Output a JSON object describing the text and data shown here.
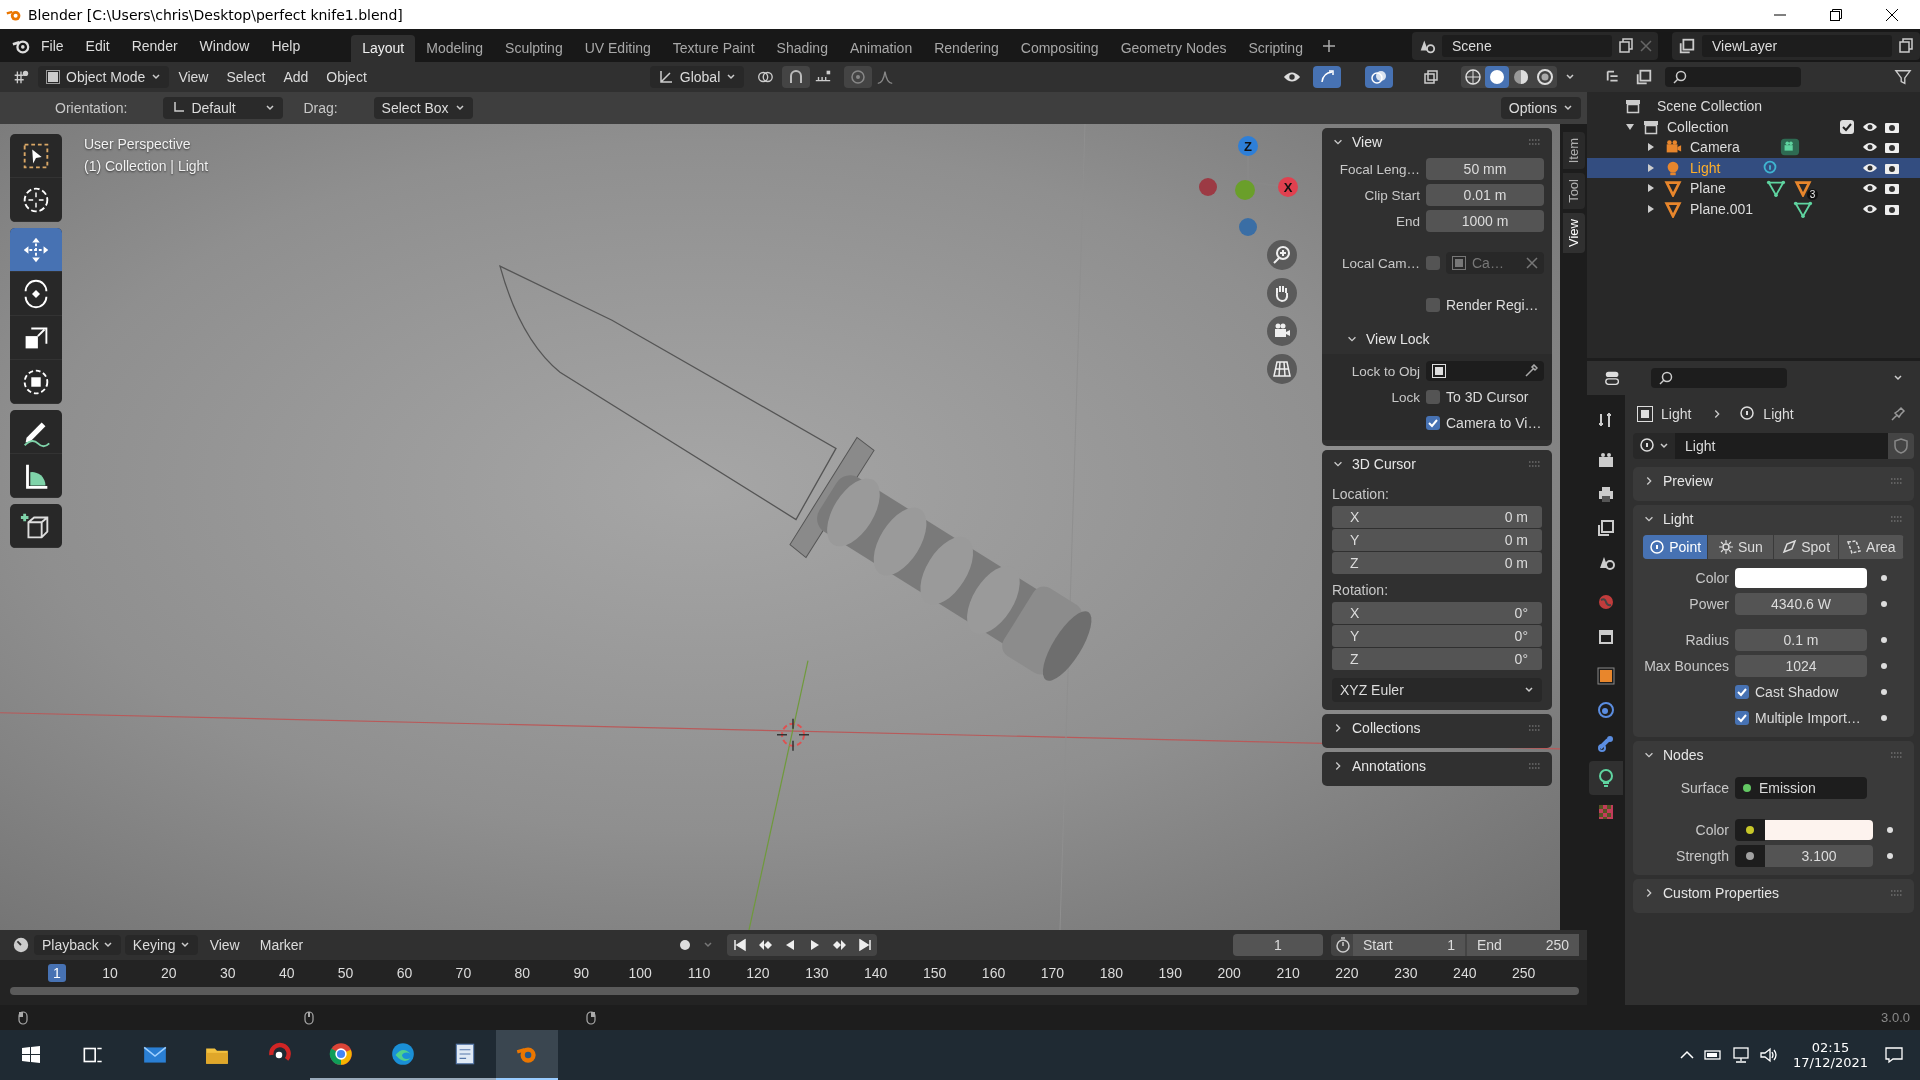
{
  "window": {
    "title": "Blender [C:\\Users\\chris\\Desktop\\perfect knife1.blend]"
  },
  "menu": [
    "File",
    "Edit",
    "Render",
    "Window",
    "Help"
  ],
  "workspaces": [
    {
      "label": "Layout",
      "selected": true
    },
    {
      "label": "Modeling",
      "selected": false
    },
    {
      "label": "Sculpting",
      "selected": false
    },
    {
      "label": "UV Editing",
      "selected": false
    },
    {
      "label": "Texture Paint",
      "selected": false
    },
    {
      "label": "Shading",
      "selected": false
    },
    {
      "label": "Animation",
      "selected": false
    },
    {
      "label": "Rendering",
      "selected": false
    },
    {
      "label": "Compositing",
      "selected": false
    },
    {
      "label": "Geometry Nodes",
      "selected": false
    },
    {
      "label": "Scripting",
      "selected": false
    }
  ],
  "scene": {
    "scene": "Scene",
    "view_layer": "ViewLayer"
  },
  "viewport_header": {
    "mode": "Object Mode",
    "menus": [
      "View",
      "Select",
      "Add",
      "Object"
    ],
    "orientation": "Global",
    "shading": [
      {
        "kind": "wireframe",
        "selected": false
      },
      {
        "kind": "solid",
        "selected": true
      },
      {
        "kind": "material",
        "selected": false
      },
      {
        "kind": "rendered",
        "selected": false
      }
    ]
  },
  "tool_settings": {
    "orientation_label": "Orientation:",
    "orientation": "Default",
    "drag_label": "Drag:",
    "drag": "Select Box",
    "options": "Options"
  },
  "toolbar": [
    [
      {
        "kind": "select",
        "selected": false
      },
      {
        "kind": "cursor",
        "selected": false
      }
    ],
    [
      {
        "kind": "move",
        "selected": true
      },
      {
        "kind": "rotate",
        "selected": false
      },
      {
        "kind": "scale",
        "selected": false
      },
      {
        "kind": "transform",
        "selected": false
      }
    ],
    [
      {
        "kind": "annotate",
        "selected": false
      },
      {
        "kind": "measure",
        "selected": false
      }
    ],
    [
      {
        "kind": "add-cube",
        "selected": false
      }
    ]
  ],
  "viewport": {
    "overlay_lines": [
      "User Perspective",
      "(1) Collection | Light"
    ],
    "gizmo": {
      "z": "Z",
      "x": "X"
    }
  },
  "sidebar_tabs": [
    {
      "label": "Item",
      "selected": false
    },
    {
      "label": "Tool",
      "selected": false
    },
    {
      "label": "View",
      "selected": true
    }
  ],
  "sidebar_panels": [
    {
      "kind": "view",
      "title": "View",
      "expanded": true,
      "fields": [
        {
          "label": "Focal Leng…",
          "value": "50 mm"
        },
        {
          "label": "Clip Start",
          "value": "0.01 m"
        },
        {
          "label": "End",
          "value": "1000 m"
        }
      ],
      "local_camera": {
        "label": "Local Cam…",
        "checked": false,
        "value": "Ca…"
      },
      "render_region": {
        "label": "Render Regi…",
        "checked": false
      },
      "view_lock": {
        "title": "View Lock",
        "expanded": true,
        "lock_to_obj": "Lock to Obj",
        "lock_label": "Lock",
        "checks": [
          {
            "label": "To 3D Cursor",
            "checked": false
          },
          {
            "label": "Camera to Vi…",
            "checked": true
          }
        ]
      }
    },
    {
      "kind": "cursor",
      "title": "3D Cursor",
      "expanded": true,
      "location_label": "Location:",
      "location": [
        {
          "axis": "X",
          "value": "0 m"
        },
        {
          "axis": "Y",
          "value": "0 m"
        },
        {
          "axis": "Z",
          "value": "0 m"
        }
      ],
      "rotation_label": "Rotation:",
      "rotation": [
        {
          "axis": "X",
          "value": "0°"
        },
        {
          "axis": "Y",
          "value": "0°"
        },
        {
          "axis": "Z",
          "value": "0°"
        }
      ],
      "rotation_mode": "XYZ Euler"
    },
    {
      "title": "Collections",
      "expanded": false
    },
    {
      "title": "Annotations",
      "expanded": false
    }
  ],
  "outliner": {
    "root": "Scene Collection",
    "items": [
      {
        "name": "Collection",
        "expanded": true,
        "checked": true,
        "children": [
          {
            "name": "Camera",
            "kind": "camera",
            "selected": false
          },
          {
            "name": "Light",
            "kind": "light",
            "selected": true
          },
          {
            "name": "Plane",
            "kind": "mesh",
            "selected": false,
            "child_count": "3"
          },
          {
            "name": "Plane.001",
            "kind": "mesh",
            "selected": false
          }
        ]
      }
    ]
  },
  "properties": {
    "tabs": [
      {
        "kind": "tool",
        "selected": false
      },
      {
        "kind": "render",
        "selected": false
      },
      {
        "kind": "output",
        "selected": false
      },
      {
        "kind": "view-layer",
        "selected": false
      },
      {
        "kind": "scene",
        "selected": false
      },
      {
        "kind": "world",
        "selected": false
      },
      {
        "kind": "collection",
        "selected": false
      },
      {
        "kind": "object",
        "selected": false
      },
      {
        "kind": "physics",
        "selected": false
      },
      {
        "kind": "constraints",
        "selected": false
      },
      {
        "kind": "data",
        "selected": true
      },
      {
        "kind": "texture",
        "selected": false
      }
    ],
    "breadcrumb": [
      "Light",
      "Light"
    ],
    "datablock": "Light",
    "panels": [
      {
        "title": "Preview",
        "expanded": false
      },
      {
        "kind": "light",
        "title": "Light",
        "expanded": true,
        "types": [
          {
            "kind": "point",
            "label": "Point",
            "selected": true
          },
          {
            "kind": "sun",
            "label": "Sun",
            "selected": false
          },
          {
            "kind": "spot",
            "label": "Spot",
            "selected": false
          },
          {
            "kind": "area",
            "label": "Area",
            "selected": false
          }
        ],
        "rows": [
          {
            "kind": "color",
            "label": "Color",
            "color": "#ffffff"
          },
          {
            "kind": "value",
            "label": "Power",
            "value": "4340.6 W"
          },
          {
            "kind": "value",
            "label": "Radius",
            "value": "0.1 m"
          },
          {
            "kind": "value",
            "label": "Max Bounces",
            "value": "1024"
          },
          {
            "kind": "check",
            "label": "Cast Shadow",
            "checked": true
          },
          {
            "kind": "check",
            "label": "Multiple Import…",
            "checked": true
          }
        ]
      },
      {
        "kind": "nodes",
        "title": "Nodes",
        "expanded": true,
        "surface_label": "Surface",
        "surface": "Emission",
        "color_label": "Color",
        "color": "#fdf3ee",
        "strength_label": "Strength",
        "strength": "3.100"
      },
      {
        "title": "Custom Properties",
        "expanded": false
      }
    ]
  },
  "timeline": {
    "menus": [
      "Playback",
      "Keying",
      "View",
      "Marker"
    ],
    "current_frame": "1",
    "start_label": "Start",
    "start": "1",
    "end_label": "End",
    "end": "250",
    "ruler": [
      {
        "label": "1",
        "selected": true
      },
      {
        "label": "10",
        "selected": false
      },
      {
        "label": "20",
        "selected": false
      },
      {
        "label": "30",
        "selected": false
      },
      {
        "label": "40",
        "selected": false
      },
      {
        "label": "50",
        "selected": false
      },
      {
        "label": "60",
        "selected": false
      },
      {
        "label": "70",
        "selected": false
      },
      {
        "label": "80",
        "selected": false
      },
      {
        "label": "90",
        "selected": false
      },
      {
        "label": "100",
        "selected": false
      },
      {
        "label": "110",
        "selected": false
      },
      {
        "label": "120",
        "selected": false
      },
      {
        "label": "130",
        "selected": false
      },
      {
        "label": "140",
        "selected": false
      },
      {
        "label": "150",
        "selected": false
      },
      {
        "label": "160",
        "selected": false
      },
      {
        "label": "170",
        "selected": false
      },
      {
        "label": "180",
        "selected": false
      },
      {
        "label": "190",
        "selected": false
      },
      {
        "label": "200",
        "selected": false
      },
      {
        "label": "210",
        "selected": false
      },
      {
        "label": "220",
        "selected": false
      },
      {
        "label": "230",
        "selected": false
      },
      {
        "label": "240",
        "selected": false
      },
      {
        "label": "250",
        "selected": false
      }
    ]
  },
  "status_bar": {
    "version": "3.0.0"
  },
  "taskbar": {
    "apps": [
      {
        "kind": "task-view",
        "selected": false
      },
      {
        "kind": "mail",
        "selected": false
      },
      {
        "kind": "folder",
        "selected": false
      },
      {
        "kind": "red-app",
        "selected": false
      },
      {
        "kind": "ball",
        "selected": false
      },
      {
        "kind": "wave",
        "selected": false
      },
      {
        "kind": "notepad",
        "selected": false
      },
      {
        "kind": "blender",
        "selected": true
      }
    ],
    "time": "02:15",
    "date": "17/12/2021"
  }
}
